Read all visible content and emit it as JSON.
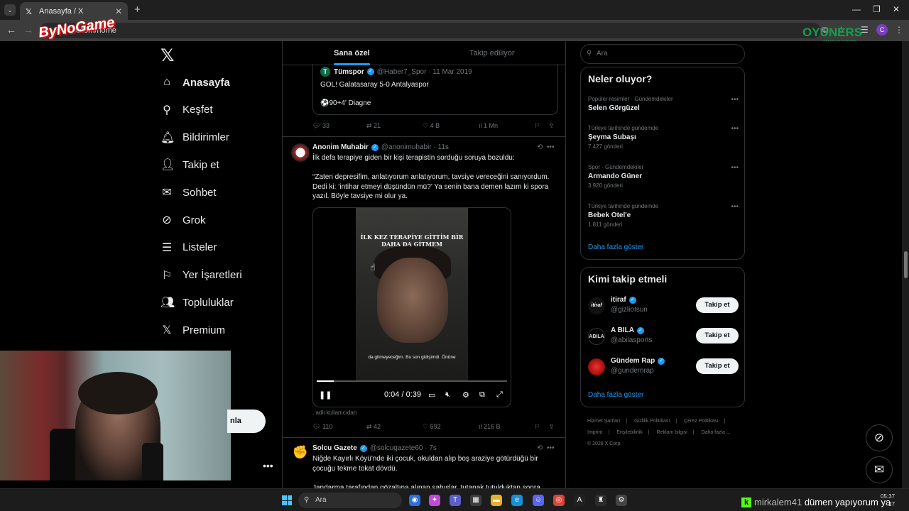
{
  "browser": {
    "tab_title": "Anasayfa / X",
    "url": "x.com/home",
    "profile_initial": "C"
  },
  "overlays": {
    "bynogame_logo": "ByNoGame",
    "oyuncu_logo": "OYUNERS",
    "oyuncu_sub": "www.oyuners",
    "kick_user": "mirkalem41",
    "kick_message": "dümen yapıyorum ya"
  },
  "sidebar": {
    "items": [
      {
        "label": "Anasayfa",
        "icon": "home-icon"
      },
      {
        "label": "Keşfet",
        "icon": "search-icon"
      },
      {
        "label": "Bildirimler",
        "icon": "bell-icon"
      },
      {
        "label": "Takip et",
        "icon": "person-add-icon"
      },
      {
        "label": "Sohbet",
        "icon": "mail-icon"
      },
      {
        "label": "Grok",
        "icon": "grok-icon"
      },
      {
        "label": "Listeler",
        "icon": "list-icon"
      },
      {
        "label": "Yer İşaretleri",
        "icon": "bookmark-icon"
      },
      {
        "label": "Topluluklar",
        "icon": "communities-icon"
      },
      {
        "label": "Premium",
        "icon": "x-icon"
      }
    ],
    "post_button_partial": "nla"
  },
  "feed": {
    "tabs": [
      "Sana özel",
      "Takip ediliyor"
    ],
    "quoted": {
      "name": "Tümspor",
      "handle": "@Haber7_Spor",
      "date": "11 Mar 2019",
      "line1": "GOL! Galatasaray 5-0 Antalyaspor",
      "line2": "⚽90+4' Diagne"
    },
    "actions1": {
      "replies": "33",
      "reposts": "21",
      "likes": "4 B",
      "views": "1 Mn"
    },
    "tweet": {
      "name": "Anonim Muhabir",
      "handle": "@anonimuhabir",
      "time": "11s",
      "lines": [
        "İlk defa terapiye giden bir kişi terapistin sorduğu soruya bozuldu:",
        "",
        "“Zaten depresifim, anlatıyorum anlatıyorum, tavsiye vereceğini sanıyordum.",
        "Dedi ki: ‘intihar etmeyi düşündün mü?’ Ya senin bana demen lazım ki spora",
        "yazıl. Böyle tavsiye mi olur ya."
      ],
      "video_caption_top": "İLK KEZ TERAPİYE GİTTİM BİR DAHA DA GİTMEM",
      "video_caption_bottom": "da gitmeyeceğim. Bu son gidişimdi. Önüne",
      "video_time": "0:04 / 0:39",
      "video_progress": 0.09,
      "source": ". adlı kullanıcıdan"
    },
    "actions2": {
      "replies": "110",
      "reposts": "42",
      "likes": "592",
      "views": "216 B"
    },
    "tweet2": {
      "name": "Solcu Gazete",
      "handle": "@solcugazete60",
      "time": "7s",
      "lines": [
        "Niğde Kayırlı Köyü'nde iki çocuk, okuldan alıp boş araziye götürdüğü bir",
        "çocuğu tekme tokat dövdü.",
        "",
        "Jandarma tarafından gözaltına alınan şahıslar, tutanak tutulduktan sonra"
      ]
    }
  },
  "right": {
    "search_placeholder": "Ara",
    "trends_title": "Neler oluyor?",
    "trends": [
      {
        "category": "Popüler resimler · Gündemdekiler",
        "name": "Selen Görgüzel",
        "count": ""
      },
      {
        "category": "Türkiye tarihinde gündemde",
        "name": "Şeyma Subaşı",
        "count": "7.427 gönderi"
      },
      {
        "category": "Spor · Gündemdekiler",
        "name": "Armando Güner",
        "count": "3.920 gönderi"
      },
      {
        "category": "Türkiye tarihinde gündemde",
        "name": "Bebek Otel'e",
        "count": "1.811 gönderi"
      }
    ],
    "show_more": "Daha fazla göster",
    "who_title": "Kimi takip etmeli",
    "who": [
      {
        "name": "itiraf",
        "handle": "@gizlioIsun",
        "button": "Takip et",
        "avatar_text": "itiraf"
      },
      {
        "name": "A BILA",
        "handle": "@abilasports",
        "button": "Takip et",
        "avatar_text": "ABILA"
      },
      {
        "name": "Gündem Rap",
        "handle": "@gundemrap",
        "button": "Takip et",
        "avatar_text": ""
      }
    ],
    "who_show_more": "Daha fazla göster",
    "footer": [
      "Hizmet Şartları",
      "Gizlilik Politikası",
      "Çerez Politikası",
      "Imprint",
      "Erişilebilirlik",
      "Reklam bilgisi",
      "Daha fazla ...",
      "© 2026 X Corp."
    ]
  },
  "taskbar": {
    "search": "Ara",
    "time": "05:37",
    "date": "27"
  },
  "colors": {
    "accent": "#1d9bf0",
    "bg": "#000000",
    "border": "#2f3336",
    "muted": "#71767b"
  }
}
